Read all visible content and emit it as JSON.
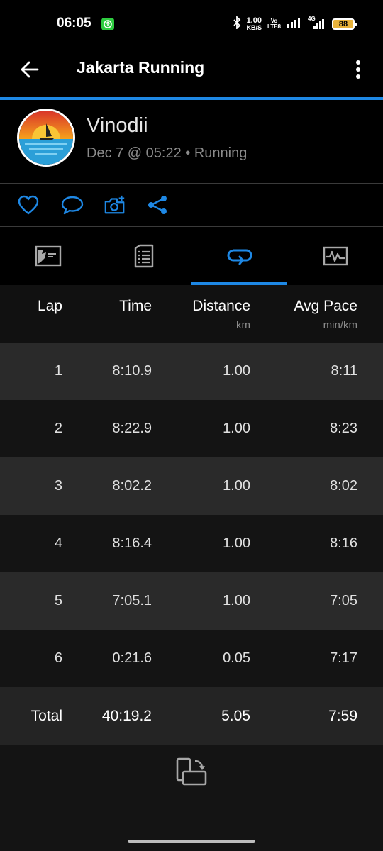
{
  "status_bar": {
    "time": "06:05",
    "net_speed_value": "1.00",
    "net_speed_unit": "KB/S",
    "volte_top": "Vo",
    "volte_bottom": "LTE8",
    "network": "4G",
    "battery": "88"
  },
  "app_bar": {
    "title": "Jakarta Running",
    "back_icon": "arrow-left-icon",
    "menu_icon": "more-vert-icon"
  },
  "activity": {
    "user_name": "Vinodii",
    "meta": "Dec 7 @ 05:22 • Running"
  },
  "actions": [
    {
      "name": "like",
      "icon": "heart-icon"
    },
    {
      "name": "comment",
      "icon": "comment-icon"
    },
    {
      "name": "add-photo",
      "icon": "camera-plus-icon"
    },
    {
      "name": "share",
      "icon": "share-icon"
    }
  ],
  "tabs": [
    {
      "name": "map",
      "icon": "map-icon",
      "selected": false
    },
    {
      "name": "stats",
      "icon": "document-list-icon",
      "selected": false
    },
    {
      "name": "laps",
      "icon": "loop-icon",
      "selected": true
    },
    {
      "name": "charts",
      "icon": "chart-icon",
      "selected": false
    }
  ],
  "table": {
    "headers": {
      "lap": "Lap",
      "time": "Time",
      "distance": "Distance",
      "distance_unit": "km",
      "pace": "Avg Pace",
      "pace_unit": "min/km"
    },
    "rows": [
      {
        "lap": "1",
        "time": "8:10.9",
        "distance": "1.00",
        "pace": "8:11"
      },
      {
        "lap": "2",
        "time": "8:22.9",
        "distance": "1.00",
        "pace": "8:23"
      },
      {
        "lap": "3",
        "time": "8:02.2",
        "distance": "1.00",
        "pace": "8:02"
      },
      {
        "lap": "4",
        "time": "8:16.4",
        "distance": "1.00",
        "pace": "8:16"
      },
      {
        "lap": "5",
        "time": "7:05.1",
        "distance": "1.00",
        "pace": "7:05"
      },
      {
        "lap": "6",
        "time": "0:21.6",
        "distance": "0.05",
        "pace": "7:17"
      }
    ],
    "total": {
      "lap": "Total",
      "time": "40:19.2",
      "distance": "5.05",
      "pace": "7:59"
    }
  },
  "colors": {
    "accent": "#1e88e5",
    "background": "#000000",
    "row_light": "#2a2a2a",
    "row_dark": "#141414"
  },
  "bottom": {
    "rotate_icon": "rotate-screen-icon"
  }
}
